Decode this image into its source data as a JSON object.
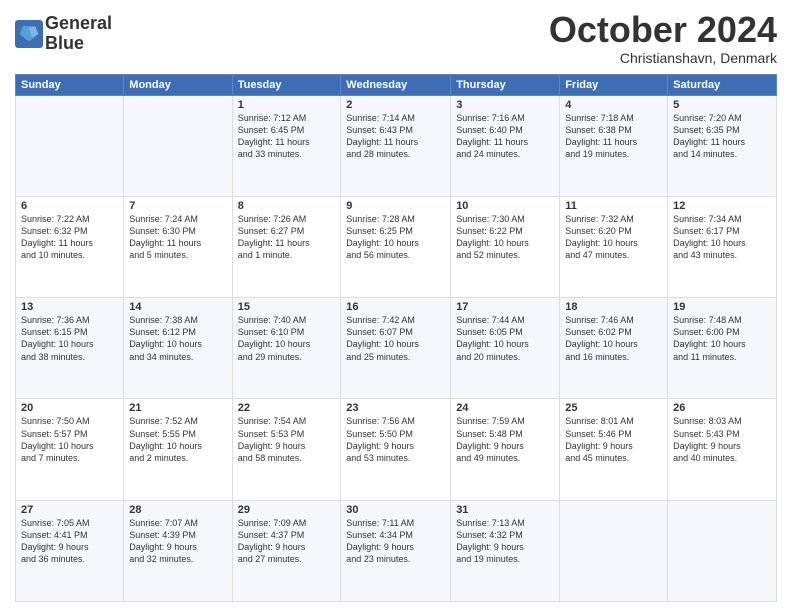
{
  "header": {
    "logo_line1": "General",
    "logo_line2": "Blue",
    "month": "October 2024",
    "location": "Christianshavn, Denmark"
  },
  "days_header": [
    "Sunday",
    "Monday",
    "Tuesday",
    "Wednesday",
    "Thursday",
    "Friday",
    "Saturday"
  ],
  "weeks": [
    [
      {
        "day": "",
        "info": ""
      },
      {
        "day": "",
        "info": ""
      },
      {
        "day": "1",
        "info": "Sunrise: 7:12 AM\nSunset: 6:45 PM\nDaylight: 11 hours\nand 33 minutes."
      },
      {
        "day": "2",
        "info": "Sunrise: 7:14 AM\nSunset: 6:43 PM\nDaylight: 11 hours\nand 28 minutes."
      },
      {
        "day": "3",
        "info": "Sunrise: 7:16 AM\nSunset: 6:40 PM\nDaylight: 11 hours\nand 24 minutes."
      },
      {
        "day": "4",
        "info": "Sunrise: 7:18 AM\nSunset: 6:38 PM\nDaylight: 11 hours\nand 19 minutes."
      },
      {
        "day": "5",
        "info": "Sunrise: 7:20 AM\nSunset: 6:35 PM\nDaylight: 11 hours\nand 14 minutes."
      }
    ],
    [
      {
        "day": "6",
        "info": "Sunrise: 7:22 AM\nSunset: 6:32 PM\nDaylight: 11 hours\nand 10 minutes."
      },
      {
        "day": "7",
        "info": "Sunrise: 7:24 AM\nSunset: 6:30 PM\nDaylight: 11 hours\nand 5 minutes."
      },
      {
        "day": "8",
        "info": "Sunrise: 7:26 AM\nSunset: 6:27 PM\nDaylight: 11 hours\nand 1 minute."
      },
      {
        "day": "9",
        "info": "Sunrise: 7:28 AM\nSunset: 6:25 PM\nDaylight: 10 hours\nand 56 minutes."
      },
      {
        "day": "10",
        "info": "Sunrise: 7:30 AM\nSunset: 6:22 PM\nDaylight: 10 hours\nand 52 minutes."
      },
      {
        "day": "11",
        "info": "Sunrise: 7:32 AM\nSunset: 6:20 PM\nDaylight: 10 hours\nand 47 minutes."
      },
      {
        "day": "12",
        "info": "Sunrise: 7:34 AM\nSunset: 6:17 PM\nDaylight: 10 hours\nand 43 minutes."
      }
    ],
    [
      {
        "day": "13",
        "info": "Sunrise: 7:36 AM\nSunset: 6:15 PM\nDaylight: 10 hours\nand 38 minutes."
      },
      {
        "day": "14",
        "info": "Sunrise: 7:38 AM\nSunset: 6:12 PM\nDaylight: 10 hours\nand 34 minutes."
      },
      {
        "day": "15",
        "info": "Sunrise: 7:40 AM\nSunset: 6:10 PM\nDaylight: 10 hours\nand 29 minutes."
      },
      {
        "day": "16",
        "info": "Sunrise: 7:42 AM\nSunset: 6:07 PM\nDaylight: 10 hours\nand 25 minutes."
      },
      {
        "day": "17",
        "info": "Sunrise: 7:44 AM\nSunset: 6:05 PM\nDaylight: 10 hours\nand 20 minutes."
      },
      {
        "day": "18",
        "info": "Sunrise: 7:46 AM\nSunset: 6:02 PM\nDaylight: 10 hours\nand 16 minutes."
      },
      {
        "day": "19",
        "info": "Sunrise: 7:48 AM\nSunset: 6:00 PM\nDaylight: 10 hours\nand 11 minutes."
      }
    ],
    [
      {
        "day": "20",
        "info": "Sunrise: 7:50 AM\nSunset: 5:57 PM\nDaylight: 10 hours\nand 7 minutes."
      },
      {
        "day": "21",
        "info": "Sunrise: 7:52 AM\nSunset: 5:55 PM\nDaylight: 10 hours\nand 2 minutes."
      },
      {
        "day": "22",
        "info": "Sunrise: 7:54 AM\nSunset: 5:53 PM\nDaylight: 9 hours\nand 58 minutes."
      },
      {
        "day": "23",
        "info": "Sunrise: 7:56 AM\nSunset: 5:50 PM\nDaylight: 9 hours\nand 53 minutes."
      },
      {
        "day": "24",
        "info": "Sunrise: 7:59 AM\nSunset: 5:48 PM\nDaylight: 9 hours\nand 49 minutes."
      },
      {
        "day": "25",
        "info": "Sunrise: 8:01 AM\nSunset: 5:46 PM\nDaylight: 9 hours\nand 45 minutes."
      },
      {
        "day": "26",
        "info": "Sunrise: 8:03 AM\nSunset: 5:43 PM\nDaylight: 9 hours\nand 40 minutes."
      }
    ],
    [
      {
        "day": "27",
        "info": "Sunrise: 7:05 AM\nSunset: 4:41 PM\nDaylight: 9 hours\nand 36 minutes."
      },
      {
        "day": "28",
        "info": "Sunrise: 7:07 AM\nSunset: 4:39 PM\nDaylight: 9 hours\nand 32 minutes."
      },
      {
        "day": "29",
        "info": "Sunrise: 7:09 AM\nSunset: 4:37 PM\nDaylight: 9 hours\nand 27 minutes."
      },
      {
        "day": "30",
        "info": "Sunrise: 7:11 AM\nSunset: 4:34 PM\nDaylight: 9 hours\nand 23 minutes."
      },
      {
        "day": "31",
        "info": "Sunrise: 7:13 AM\nSunset: 4:32 PM\nDaylight: 9 hours\nand 19 minutes."
      },
      {
        "day": "",
        "info": ""
      },
      {
        "day": "",
        "info": ""
      }
    ]
  ]
}
